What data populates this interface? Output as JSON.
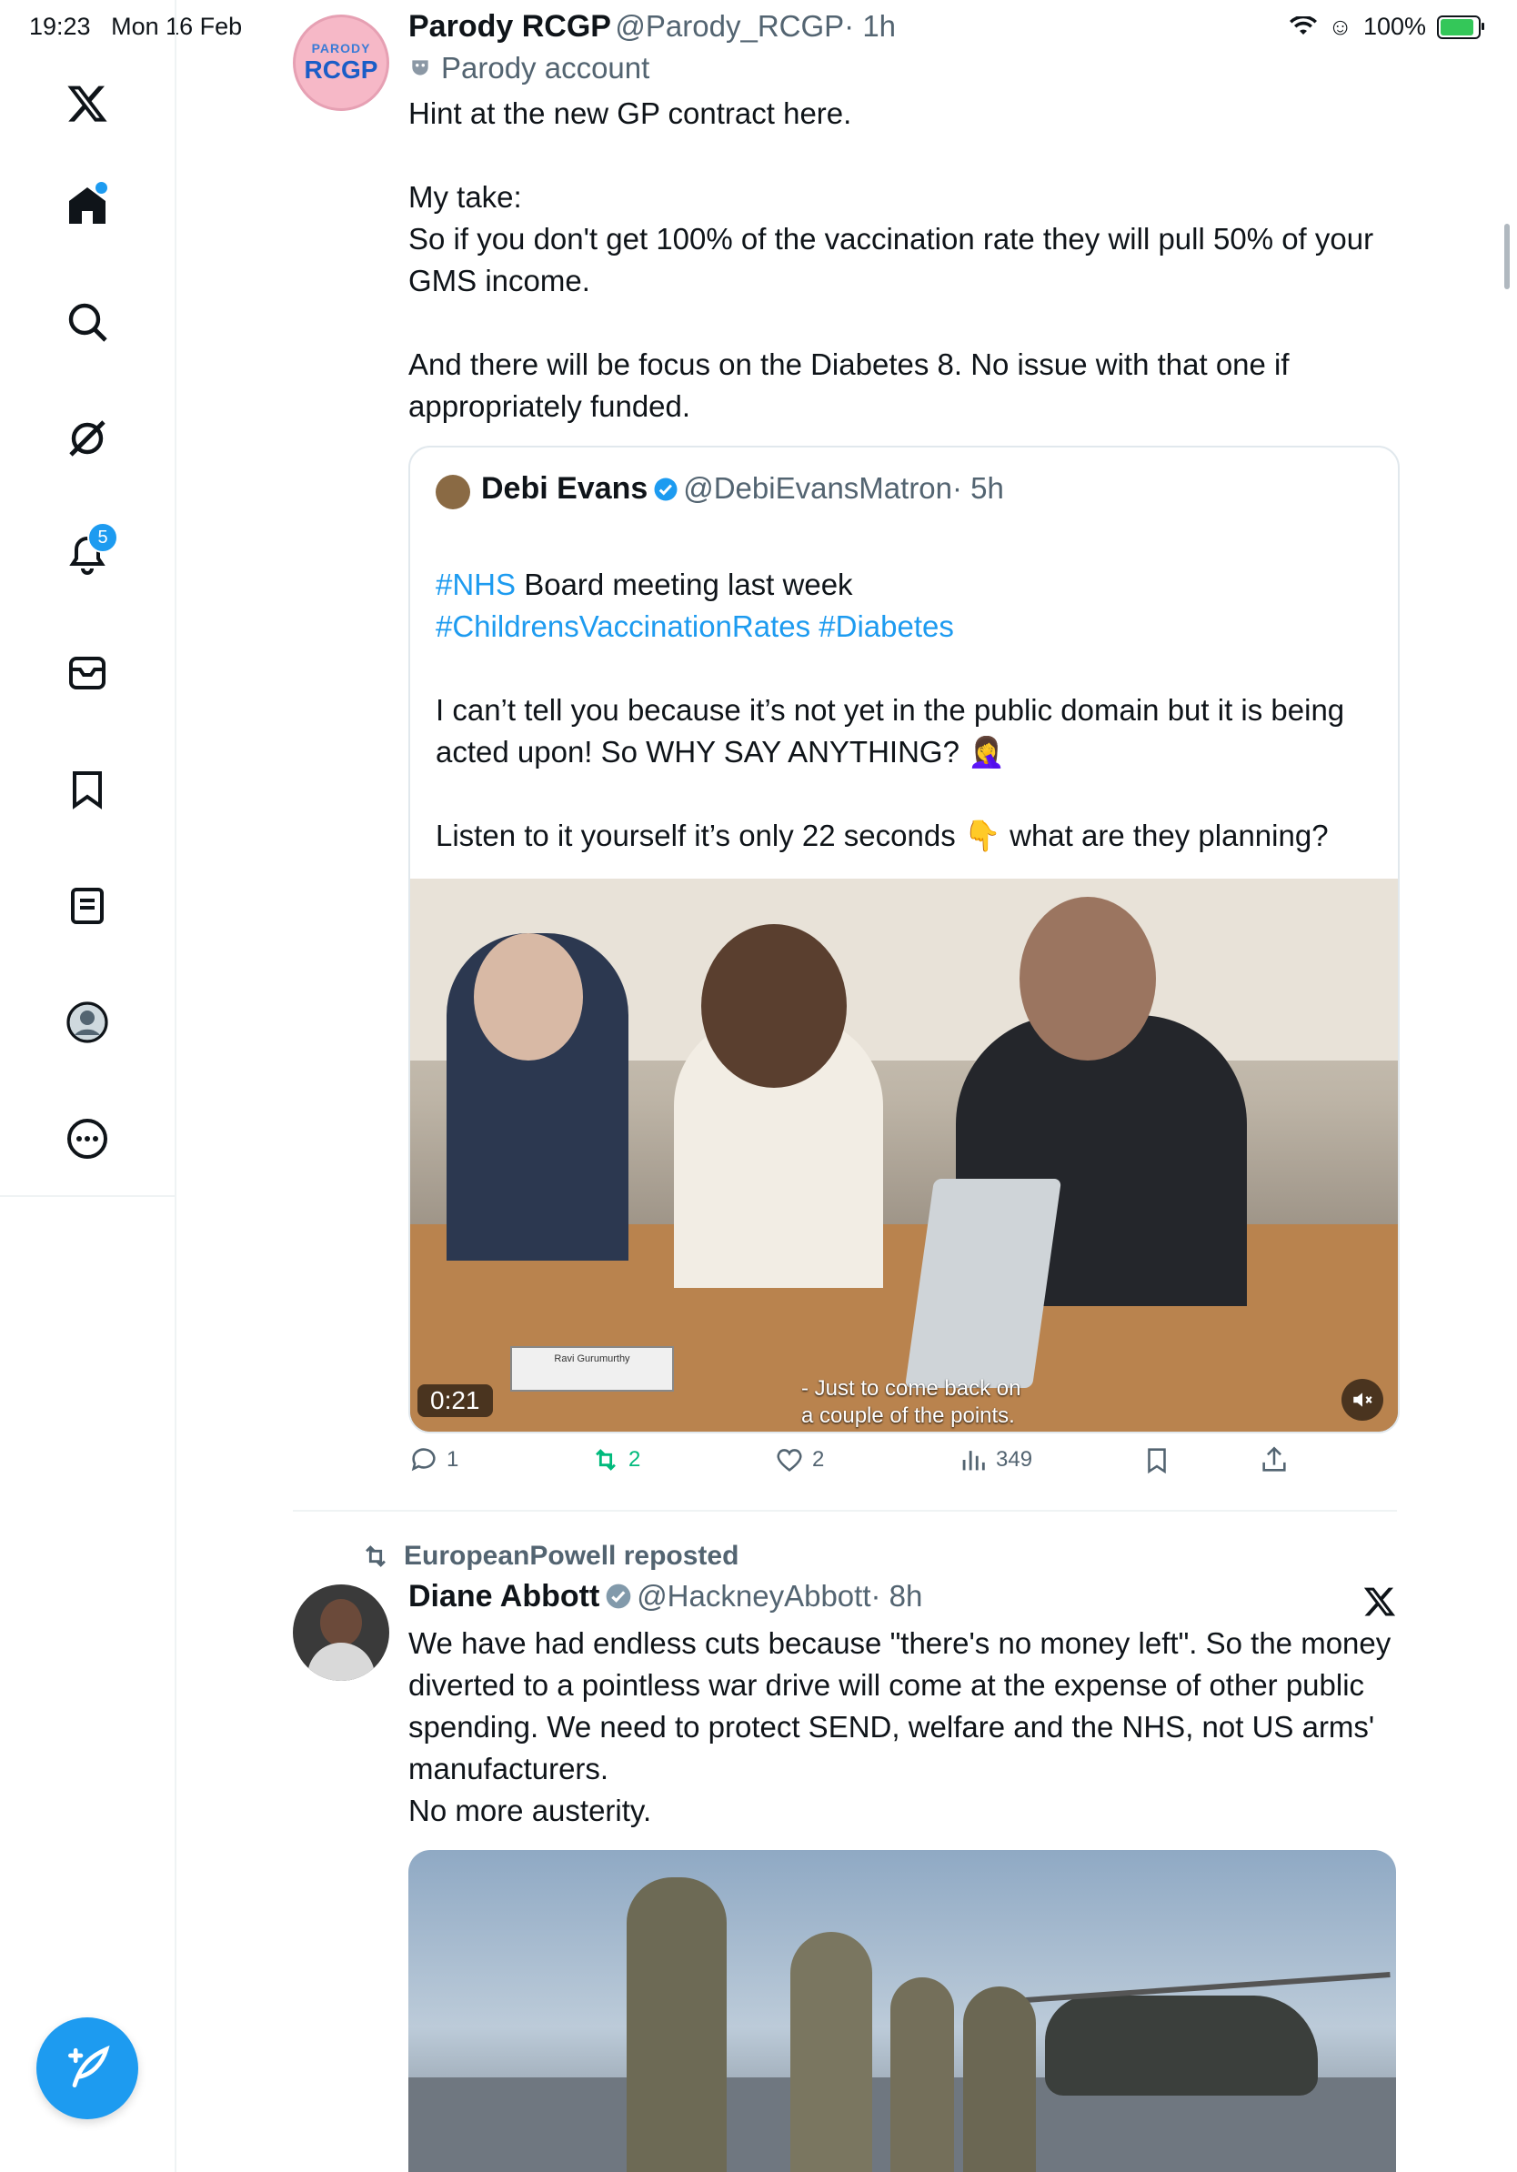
{
  "status_bar": {
    "time": "19:23",
    "date": "Mon 16 Feb",
    "battery": "100%"
  },
  "sidebar": {
    "items": [
      {
        "icon": "x-logo-icon",
        "label": ""
      },
      {
        "icon": "home-icon",
        "label": ""
      },
      {
        "icon": "search-icon",
        "label": ""
      },
      {
        "icon": "grok-icon",
        "label": ""
      },
      {
        "icon": "bell-icon",
        "label": "",
        "badge": "5"
      },
      {
        "icon": "mail-icon",
        "label": ""
      },
      {
        "icon": "bookmark-icon",
        "label": ""
      },
      {
        "icon": "list-icon",
        "label": ""
      },
      {
        "icon": "profile-icon",
        "label": ""
      },
      {
        "icon": "more-icon",
        "label": ""
      }
    ],
    "compose_icon": "compose-icon"
  },
  "tweet1": {
    "avatar_text_top": "PARODY",
    "avatar_text_main": "RCGP",
    "name": "Parody RCGP",
    "handle": "@Parody_RCGP",
    "time": "· 1h",
    "parody_label": "Parody account",
    "body": "Hint at the new GP contract here.\n\nMy take:\nSo if you don't get 100% of the vaccination rate they will pull 50% of your GMS income.\n\nAnd there will be focus on the Diabetes 8. No issue with that one if appropriately funded.",
    "quote": {
      "name": "Debi Evans",
      "handle": "@DebiEvansMatron",
      "time": "· 5h",
      "line1_hashtag": "#NHS",
      "line1_rest": " Board meeting last week",
      "hashtags": "#ChildrensVaccinationRates #Diabetes",
      "body": "I can’t tell you because it’s not yet in the public domain but it is being acted upon! So WHY SAY ANYTHING? 🤦‍♀️\n\nListen to it yourself it’s only 22 seconds 👇 what are they planning?",
      "video_time": "0:21",
      "caption": "- Just to come back on\na couple of the points.",
      "nameplate": "Ravi Gurumurthy"
    },
    "actions": {
      "replies": "1",
      "reposts": "2",
      "likes": "2",
      "views": "349"
    }
  },
  "tweet2": {
    "repost_label": "EuropeanPowell reposted",
    "name": "Diane Abbott",
    "handle": "@HackneyAbbott",
    "time": "· 8h",
    "body": "We have had endless cuts because \"there's no money left\". So the money diverted to a pointless war drive will come at the expense of other public spending. We need to protect SEND, welfare and the NHS, not US arms' manufacturers.\nNo more austerity."
  },
  "colors": {
    "accent": "#1d9bf0",
    "repost": "#00ba7c",
    "text": "#0f1419",
    "secondary": "#536471"
  }
}
